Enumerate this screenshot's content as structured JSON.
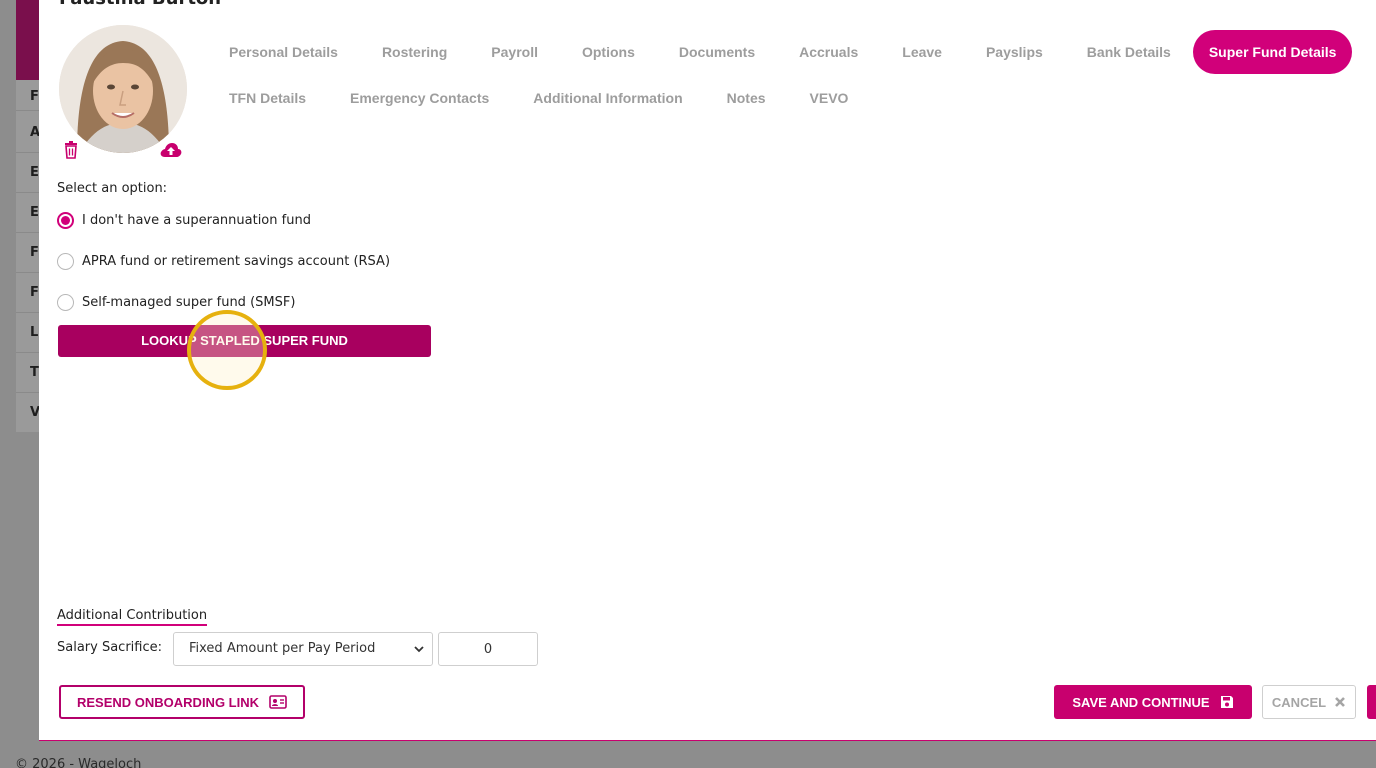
{
  "background": {
    "sidebar_letters": [
      "F",
      "A",
      "E",
      "E",
      "F",
      "F",
      "L",
      "T",
      "V"
    ],
    "footer_text": "© 2026 - Wageloch"
  },
  "modal": {
    "title": "Faustina Burton"
  },
  "tabs": {
    "row1": [
      "Personal Details",
      "Rostering",
      "Payroll",
      "Options",
      "Documents",
      "Accruals",
      "Leave",
      "Payslips",
      "Bank Details",
      "Super Fund Details"
    ],
    "row2": [
      "TFN Details",
      "Emergency Contacts",
      "Additional Information",
      "Notes",
      "VEVO"
    ],
    "active": "Super Fund Details"
  },
  "super_fund": {
    "select_label": "Select an option:",
    "options": [
      {
        "label": "I don't have a superannuation fund",
        "checked": true
      },
      {
        "label": "APRA fund or retirement savings account (RSA)",
        "checked": false
      },
      {
        "label": "Self-managed super fund (SMSF)",
        "checked": false
      }
    ],
    "lookup_button": "LOOKUP STAPLED SUPER FUND"
  },
  "additional_contribution": {
    "heading": "Additional Contribution",
    "salary_sacrifice_label": "Salary Sacrifice:",
    "salary_sacrifice_type": "Fixed Amount per Pay Period",
    "amount": "0"
  },
  "footer_buttons": {
    "resend": "RESEND ONBOARDING LINK",
    "save": "SAVE AND CONTINUE",
    "cancel": "CANCEL"
  },
  "colors": {
    "accent": "#d1007a",
    "button_dark": "#a8005f",
    "cursor_highlight": "#e6b10e"
  },
  "icons": {
    "delete_photo": "trash-icon",
    "upload_photo": "cloud-upload-icon",
    "resend": "id-card-icon",
    "save": "floppy-disk-icon",
    "cancel": "close-icon",
    "select": "chevron-down-icon"
  }
}
